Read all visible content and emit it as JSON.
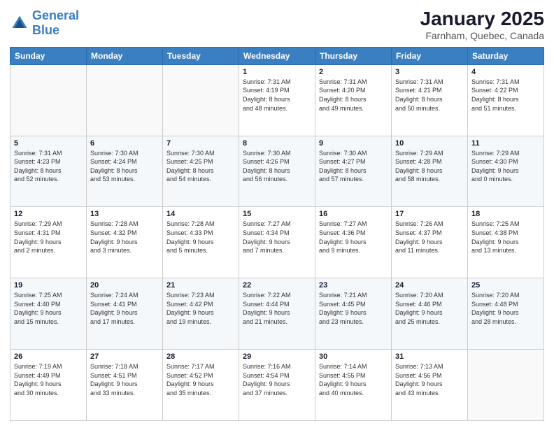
{
  "logo": {
    "text_general": "General",
    "text_blue": "Blue"
  },
  "header": {
    "month": "January 2025",
    "location": "Farnham, Quebec, Canada"
  },
  "weekdays": [
    "Sunday",
    "Monday",
    "Tuesday",
    "Wednesday",
    "Thursday",
    "Friday",
    "Saturday"
  ],
  "weeks": [
    [
      null,
      null,
      null,
      {
        "day": "1",
        "sunrise": "7:31 AM",
        "sunset": "4:19 PM",
        "daylight": "8 hours and 48 minutes."
      },
      {
        "day": "2",
        "sunrise": "7:31 AM",
        "sunset": "4:20 PM",
        "daylight": "8 hours and 49 minutes."
      },
      {
        "day": "3",
        "sunrise": "7:31 AM",
        "sunset": "4:21 PM",
        "daylight": "8 hours and 50 minutes."
      },
      {
        "day": "4",
        "sunrise": "7:31 AM",
        "sunset": "4:22 PM",
        "daylight": "8 hours and 51 minutes."
      }
    ],
    [
      {
        "day": "5",
        "sunrise": "7:31 AM",
        "sunset": "4:23 PM",
        "daylight": "8 hours and 52 minutes."
      },
      {
        "day": "6",
        "sunrise": "7:30 AM",
        "sunset": "4:24 PM",
        "daylight": "8 hours and 53 minutes."
      },
      {
        "day": "7",
        "sunrise": "7:30 AM",
        "sunset": "4:25 PM",
        "daylight": "8 hours and 54 minutes."
      },
      {
        "day": "8",
        "sunrise": "7:30 AM",
        "sunset": "4:26 PM",
        "daylight": "8 hours and 56 minutes."
      },
      {
        "day": "9",
        "sunrise": "7:30 AM",
        "sunset": "4:27 PM",
        "daylight": "8 hours and 57 minutes."
      },
      {
        "day": "10",
        "sunrise": "7:29 AM",
        "sunset": "4:28 PM",
        "daylight": "8 hours and 58 minutes."
      },
      {
        "day": "11",
        "sunrise": "7:29 AM",
        "sunset": "4:30 PM",
        "daylight": "9 hours and 0 minutes."
      }
    ],
    [
      {
        "day": "12",
        "sunrise": "7:29 AM",
        "sunset": "4:31 PM",
        "daylight": "9 hours and 2 minutes."
      },
      {
        "day": "13",
        "sunrise": "7:28 AM",
        "sunset": "4:32 PM",
        "daylight": "9 hours and 3 minutes."
      },
      {
        "day": "14",
        "sunrise": "7:28 AM",
        "sunset": "4:33 PM",
        "daylight": "9 hours and 5 minutes."
      },
      {
        "day": "15",
        "sunrise": "7:27 AM",
        "sunset": "4:34 PM",
        "daylight": "9 hours and 7 minutes."
      },
      {
        "day": "16",
        "sunrise": "7:27 AM",
        "sunset": "4:36 PM",
        "daylight": "9 hours and 9 minutes."
      },
      {
        "day": "17",
        "sunrise": "7:26 AM",
        "sunset": "4:37 PM",
        "daylight": "9 hours and 11 minutes."
      },
      {
        "day": "18",
        "sunrise": "7:25 AM",
        "sunset": "4:38 PM",
        "daylight": "9 hours and 13 minutes."
      }
    ],
    [
      {
        "day": "19",
        "sunrise": "7:25 AM",
        "sunset": "4:40 PM",
        "daylight": "9 hours and 15 minutes."
      },
      {
        "day": "20",
        "sunrise": "7:24 AM",
        "sunset": "4:41 PM",
        "daylight": "9 hours and 17 minutes."
      },
      {
        "day": "21",
        "sunrise": "7:23 AM",
        "sunset": "4:42 PM",
        "daylight": "9 hours and 19 minutes."
      },
      {
        "day": "22",
        "sunrise": "7:22 AM",
        "sunset": "4:44 PM",
        "daylight": "9 hours and 21 minutes."
      },
      {
        "day": "23",
        "sunrise": "7:21 AM",
        "sunset": "4:45 PM",
        "daylight": "9 hours and 23 minutes."
      },
      {
        "day": "24",
        "sunrise": "7:20 AM",
        "sunset": "4:46 PM",
        "daylight": "9 hours and 25 minutes."
      },
      {
        "day": "25",
        "sunrise": "7:20 AM",
        "sunset": "4:48 PM",
        "daylight": "9 hours and 28 minutes."
      }
    ],
    [
      {
        "day": "26",
        "sunrise": "7:19 AM",
        "sunset": "4:49 PM",
        "daylight": "9 hours and 30 minutes."
      },
      {
        "day": "27",
        "sunrise": "7:18 AM",
        "sunset": "4:51 PM",
        "daylight": "9 hours and 33 minutes."
      },
      {
        "day": "28",
        "sunrise": "7:17 AM",
        "sunset": "4:52 PM",
        "daylight": "9 hours and 35 minutes."
      },
      {
        "day": "29",
        "sunrise": "7:16 AM",
        "sunset": "4:54 PM",
        "daylight": "9 hours and 37 minutes."
      },
      {
        "day": "30",
        "sunrise": "7:14 AM",
        "sunset": "4:55 PM",
        "daylight": "9 hours and 40 minutes."
      },
      {
        "day": "31",
        "sunrise": "7:13 AM",
        "sunset": "4:56 PM",
        "daylight": "9 hours and 43 minutes."
      },
      null
    ]
  ]
}
